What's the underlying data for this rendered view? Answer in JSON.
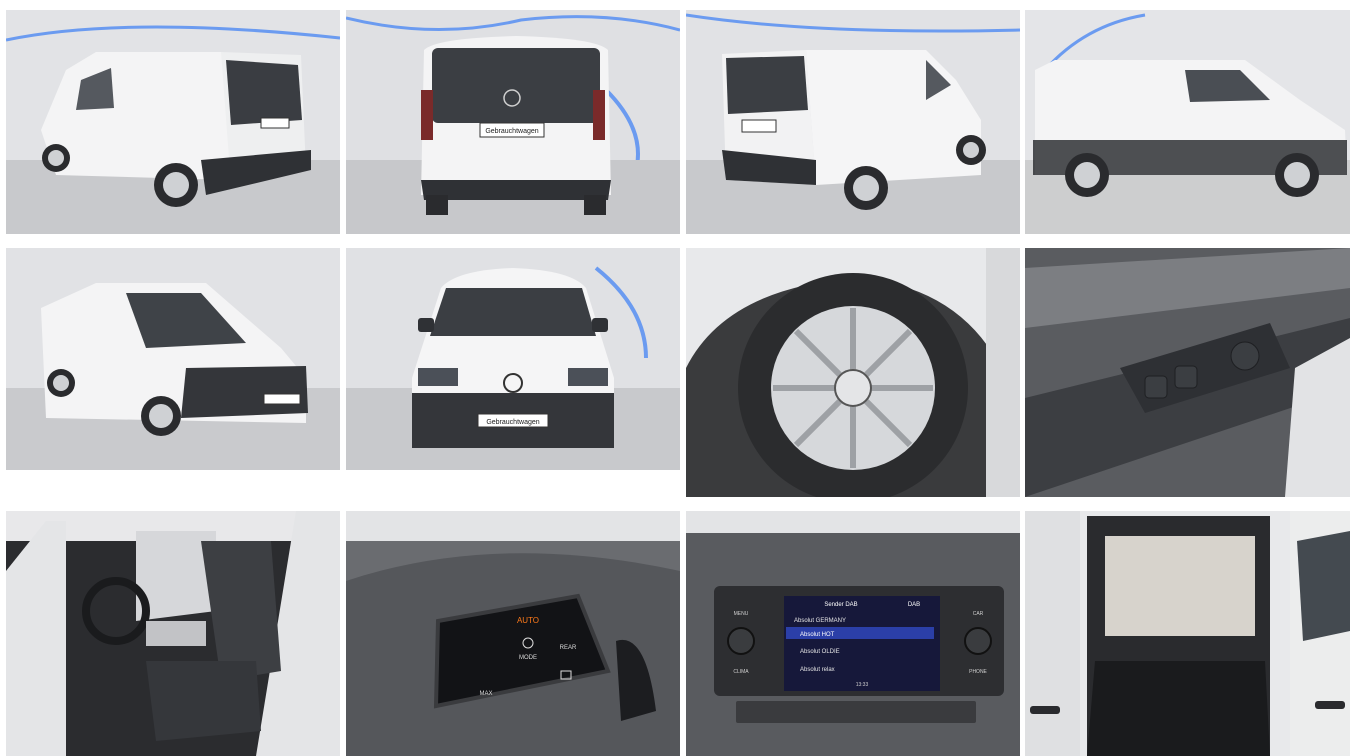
{
  "gallery": {
    "items": [
      {
        "alt": "",
        "view": "rear-left three-quarter exterior"
      },
      {
        "alt": "",
        "view": "rear exterior"
      },
      {
        "alt": "",
        "view": "rear-right three-quarter exterior"
      },
      {
        "alt": "",
        "view": "right side exterior"
      },
      {
        "alt": "",
        "view": "front-left three-quarter exterior"
      },
      {
        "alt": "",
        "view": "front exterior"
      },
      {
        "alt": "",
        "view": "wheel with hubcap"
      },
      {
        "alt": "",
        "view": "door window switches"
      },
      {
        "alt": "",
        "view": "driver seat interior"
      },
      {
        "alt": "",
        "view": "climate control panel"
      },
      {
        "alt": "",
        "view": "infotainment radio"
      },
      {
        "alt": "",
        "view": "cargo area"
      }
    ]
  },
  "plates": {
    "rear": "Gebrauchtwagen",
    "front": "Gebrauchtwagen"
  },
  "climate": {
    "auto": "AUTO",
    "mode": "MODE",
    "rear": "REAR",
    "max": "MAX"
  },
  "radio": {
    "header": "Sender DAB",
    "band": "DAB",
    "stations": [
      "Absolut GERMANY",
      "Absolut HOT",
      "Absolut OLDIE",
      "Absolut relax"
    ],
    "time": "13:33",
    "left_buttons": [
      "MENU",
      "CLIMA"
    ],
    "right_buttons": [
      "CAR",
      "PHONE"
    ]
  },
  "colors": {
    "van_white": "#f3f4f5",
    "studio_bg": "#dcdde0",
    "floor": "#c9cacd",
    "dark_trim": "#3a3c3f",
    "accent_blue": "#5b8fe8",
    "screen_blue": "#2b3fa8"
  }
}
